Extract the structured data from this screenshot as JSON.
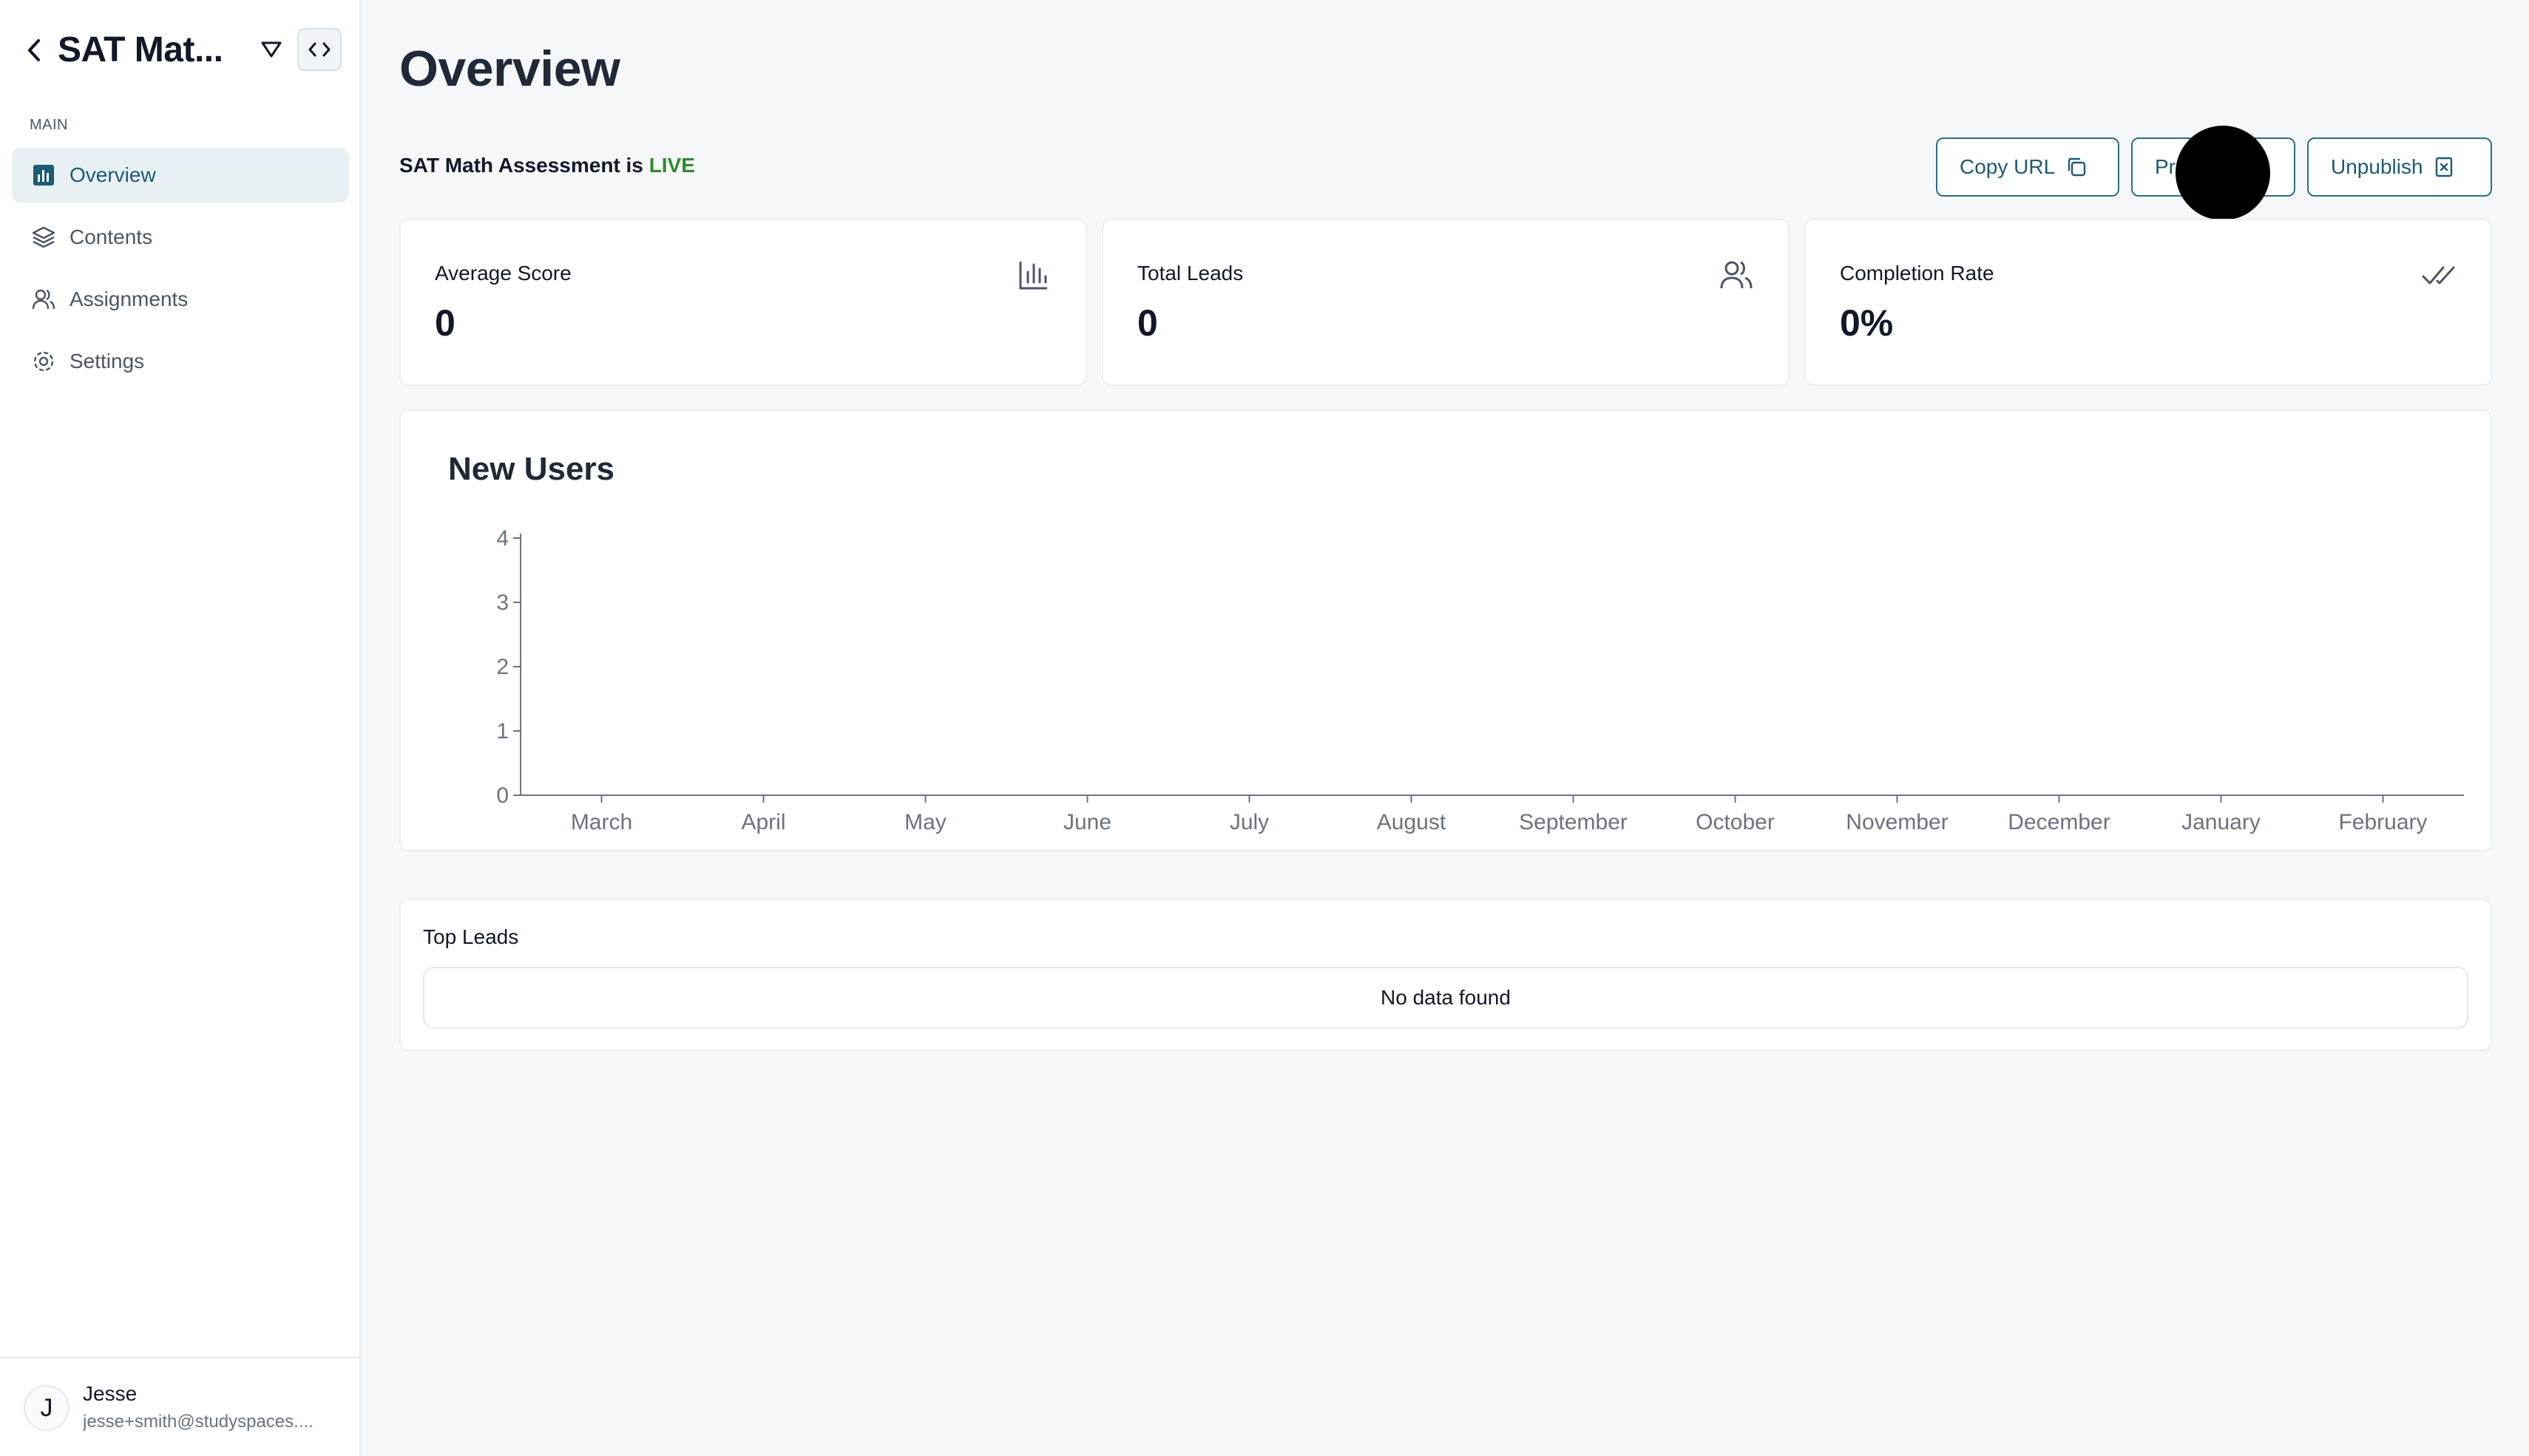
{
  "sidebar": {
    "project_title": "SAT Mat...",
    "section_label": "MAIN",
    "items": [
      {
        "label": "Overview",
        "icon": "chart-icon",
        "active": true
      },
      {
        "label": "Contents",
        "icon": "layers-icon",
        "active": false
      },
      {
        "label": "Assignments",
        "icon": "users-icon",
        "active": false
      },
      {
        "label": "Settings",
        "icon": "gear-icon",
        "active": false
      }
    ],
    "user": {
      "initial": "J",
      "name": "Jesse",
      "email": "jesse+smith@studyspaces...."
    }
  },
  "header": {
    "title": "Overview",
    "status_prefix": "SAT Math Assessment is ",
    "status_value": "LIVE",
    "buttons": {
      "copy_url": "Copy URL",
      "preview": "Preview",
      "unpublish": "Unpublish"
    }
  },
  "stats": [
    {
      "label": "Average Score",
      "value": "0",
      "icon": "bar-chart-icon"
    },
    {
      "label": "Total Leads",
      "value": "0",
      "icon": "users-icon"
    },
    {
      "label": "Completion Rate",
      "value": "0%",
      "icon": "double-check-icon"
    }
  ],
  "chart_data": {
    "type": "line",
    "title": "New Users",
    "categories": [
      "March",
      "April",
      "May",
      "June",
      "July",
      "August",
      "September",
      "October",
      "November",
      "December",
      "January",
      "February"
    ],
    "values": [
      0,
      0,
      0,
      0,
      0,
      0,
      0,
      0,
      0,
      0,
      0,
      0
    ],
    "ylim": [
      0,
      4
    ],
    "yticks": [
      0,
      1,
      2,
      3,
      4
    ],
    "grid": false
  },
  "leads": {
    "title": "Top Leads",
    "empty_text": "No data found"
  },
  "colors": {
    "accent": "#1d5a73",
    "live": "#2e8b2e",
    "active_bg": "#e8f0f4"
  }
}
